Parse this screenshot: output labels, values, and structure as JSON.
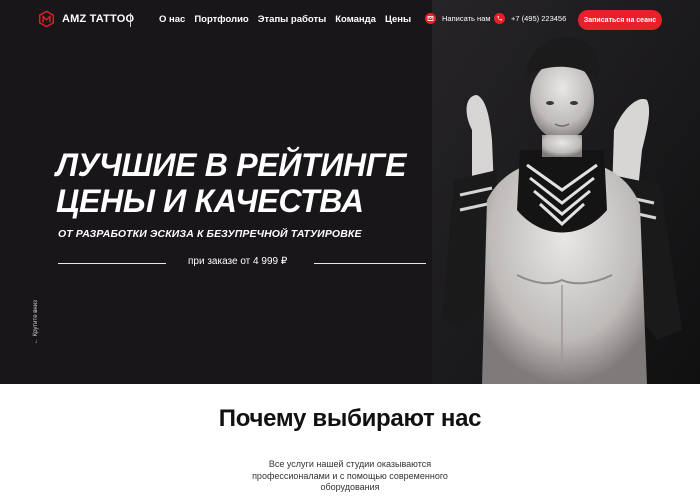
{
  "brand": {
    "name": "AMZ TATTOO"
  },
  "nav": {
    "items": [
      {
        "label": "О нас"
      },
      {
        "label": "Портфолио"
      },
      {
        "label": "Этапы работы"
      },
      {
        "label": "Команда"
      },
      {
        "label": "Цены"
      }
    ]
  },
  "contacts": {
    "write_label": "Написать нам",
    "phone": "+7 (495) 223456"
  },
  "cta": {
    "label": "Записаться на сеанс"
  },
  "hero": {
    "headline_line1": "ЛУЧШИЕ В РЕЙТИНГЕ",
    "headline_line2": "ЦЕНЫ И КАЧЕСТВА",
    "subline": "ОТ РАЗРАБОТКИ ЭСКИЗА К БЕЗУПРЕЧНОЙ ТАТУИРОВКЕ",
    "price": "при заказе от 4 999 ₽",
    "scroll_label": "← Крутите вниз"
  },
  "why": {
    "title": "Почему выбирают нас",
    "text": "Все услуги нашей студии оказываются профессионалами и с помощью современного оборудования"
  },
  "colors": {
    "accent": "#e8202a",
    "hero_bg": "#181619"
  },
  "icons": [
    "logo-icon",
    "mail-icon",
    "phone-icon"
  ]
}
